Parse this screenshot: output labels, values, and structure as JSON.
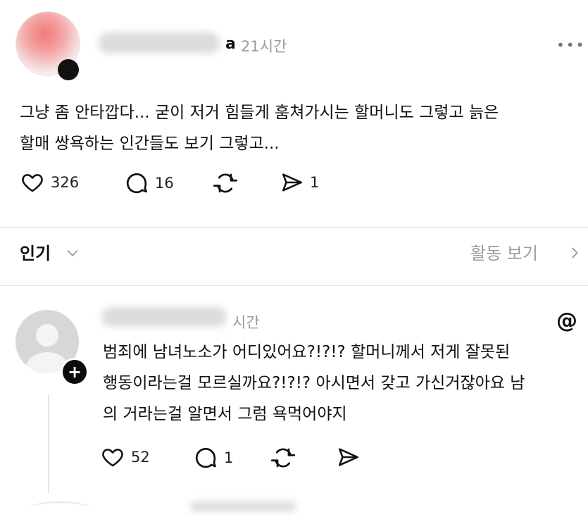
{
  "post": {
    "username_visible": "a",
    "time": "21시간",
    "more": "•••",
    "text": "그냥 좀 안타깝다... 굳이 저거 힘들게 훔쳐가시는 할머니도 그렇고  늙은\n할매 쌍욕하는 인간들도 보기 그렇고...",
    "likes": "326",
    "comments": "16",
    "shares": "1"
  },
  "sort": {
    "label": "인기",
    "activity": "활동 보기"
  },
  "reply": {
    "time": "시간",
    "text": "범죄에 남녀노소가 어디있어요?!?!? 할머니께서 저게 잘못된\n행동이라는걸 모르실까요?!?!? 아시면서 갖고 가신거잖아요 남\n의 거라는걸 알면서 그럼 욕먹어야지",
    "likes": "52",
    "comments": "1",
    "plus": "+",
    "logo": "@"
  },
  "icons": [
    "heart-icon",
    "comment-icon",
    "repost-icon",
    "send-icon",
    "chevron-down-icon",
    "chevron-right-icon",
    "threads-logo-icon",
    "plus-icon"
  ]
}
